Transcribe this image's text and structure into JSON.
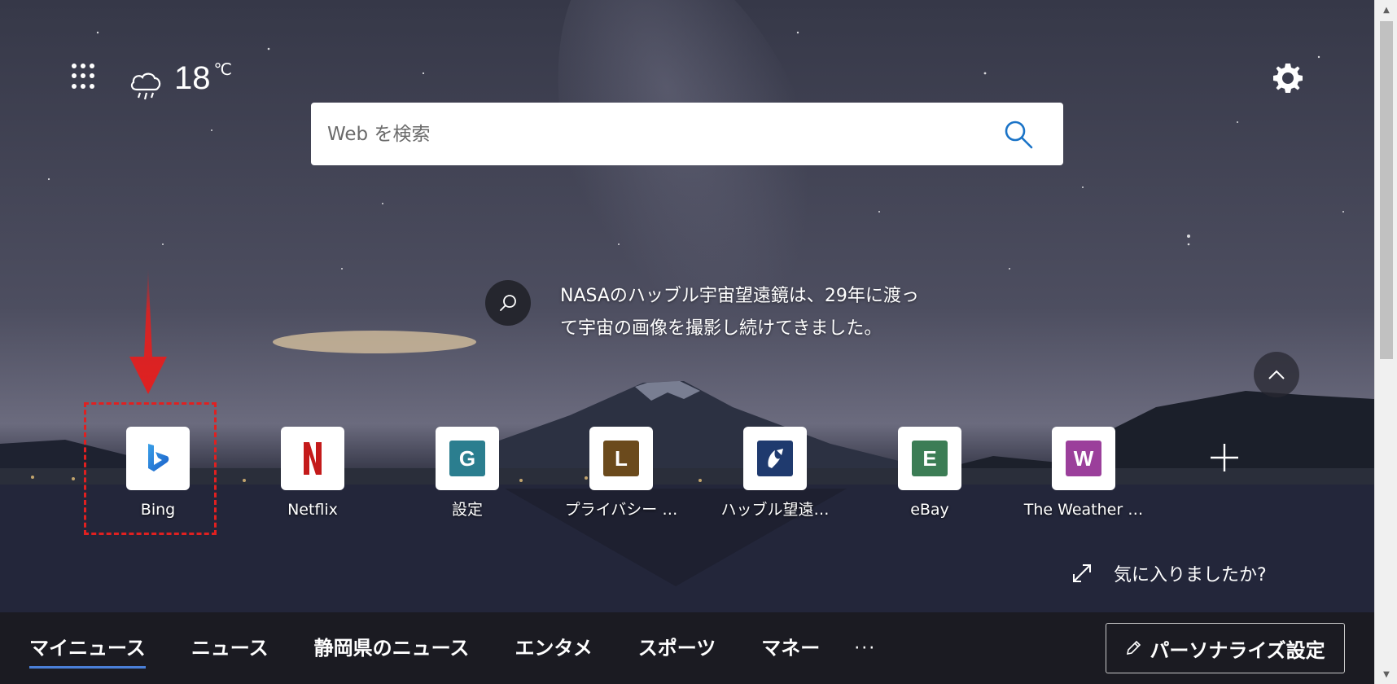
{
  "header": {
    "apps_icon": "waffle-grid-icon",
    "weather": {
      "icon": "cloud-rain-icon",
      "temperature": "18",
      "unit": "℃"
    },
    "settings_icon": "gear-icon"
  },
  "search": {
    "placeholder": "Web を検索",
    "value": "",
    "icon": "search-icon"
  },
  "image_caption": {
    "icon": "search-icon",
    "text": "NASAのハッブル宇宙望遠鏡は、29年に渡って宇宙の画像を撮影し続けてきました。"
  },
  "quick_links": [
    {
      "label": "Bing",
      "icon": "bing-logo-icon"
    },
    {
      "label": "Netflix",
      "icon": "netflix-logo-icon",
      "letter": "N",
      "color": "#c41a1a"
    },
    {
      "label": "設定",
      "letter": "G",
      "color": "#2b7e8f"
    },
    {
      "label": "プライバシー …",
      "letter": "L",
      "color": "#6b4a1c"
    },
    {
      "label": "ハッブル望遠…",
      "icon": "hubble-logo-icon",
      "color": "#1f3a6e"
    },
    {
      "label": "eBay",
      "letter": "E",
      "color": "#3c7d55"
    },
    {
      "label": "The Weather …",
      "letter": "W",
      "color": "#9b3f9b"
    }
  ],
  "add_link_icon": "plus-icon",
  "collapse_icon": "chevron-up-icon",
  "feedback": {
    "icon": "expand-icon",
    "text": "気に入りましたか?"
  },
  "bottom_nav": {
    "tabs": [
      "マイニュース",
      "ニュース",
      "静岡県のニュース",
      "エンタメ",
      "スポーツ",
      "マネー"
    ],
    "active_index": 0,
    "more": "···",
    "personalize": {
      "icon": "pencil-icon",
      "label": "パーソナライズ設定"
    }
  },
  "colors": {
    "annotation_red": "#e02020",
    "active_tab_underline": "#4a7fd8"
  }
}
